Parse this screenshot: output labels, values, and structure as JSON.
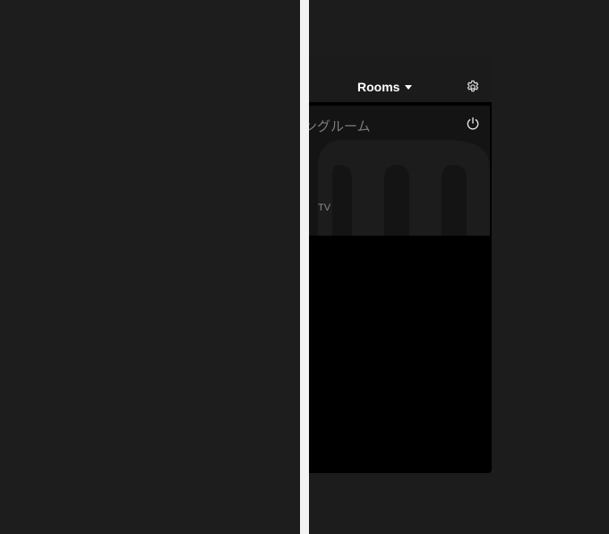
{
  "header": {
    "rooms_label": "Rooms"
  },
  "room": {
    "name": "ングルーム",
    "source": "TV"
  },
  "icons": {
    "rooms_dropdown": "chevron-down-icon",
    "settings": "gear-icon",
    "power": "power-icon"
  },
  "colors": {
    "accent_text": "#ffffff",
    "divider": "#f3f3f3"
  }
}
